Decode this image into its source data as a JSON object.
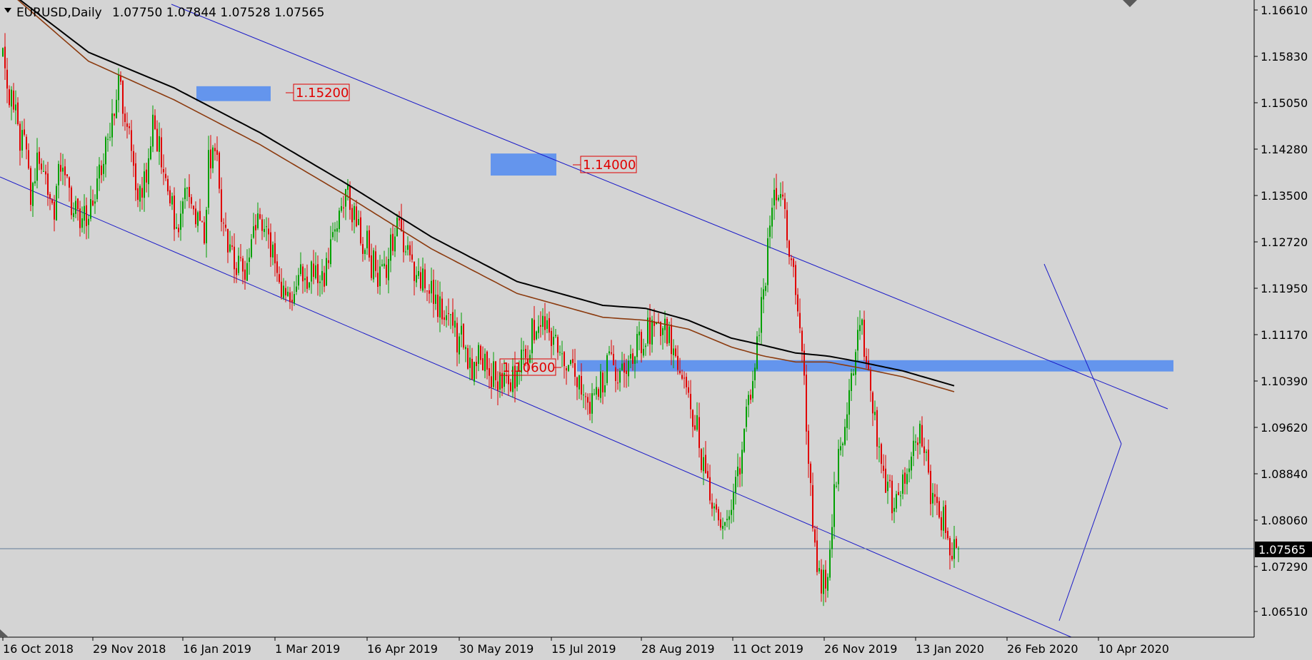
{
  "header": {
    "symbol": "EURUSD,Daily",
    "ohlc": "1.07750 1.07844 1.07528 1.07565"
  },
  "colors": {
    "background": "#d4d4d4",
    "bull": "#00a000",
    "bear": "#e00000",
    "ma_fast": "#8b3a0e",
    "ma_slow": "#000000",
    "trendline": "#1a1ac8",
    "zone": "#6495ed"
  },
  "chart_data": {
    "type": "candlestick",
    "title": "EURUSD,Daily",
    "ylim": [
      1.062,
      1.165
    ],
    "y_ticks": [
      "1.16610",
      "1.15830",
      "1.15050",
      "1.14280",
      "1.13500",
      "1.12720",
      "1.11950",
      "1.11170",
      "1.10390",
      "1.09620",
      "1.08840",
      "1.08060",
      "1.07290",
      "1.06510"
    ],
    "x_ticks": [
      "16 Oct 2018",
      "29 Nov 2018",
      "16 Jan 2019",
      "1 Mar 2019",
      "16 Apr 2019",
      "30 May 2019",
      "15 Jul 2019",
      "28 Aug 2019",
      "11 Oct 2019",
      "26 Nov 2019",
      "13 Jan 2020",
      "26 Feb 2020",
      "10 Apr 2020"
    ],
    "current_price": "1.07565",
    "levels": [
      {
        "price": 1.152,
        "label": "1.15200"
      },
      {
        "price": 1.14,
        "label": "1.14000"
      },
      {
        "price": 1.106,
        "label": "1.10600"
      }
    ],
    "path_points": [
      [
        0,
        1.158
      ],
      [
        4,
        1.15
      ],
      [
        8,
        1.144
      ],
      [
        10,
        1.146
      ],
      [
        13,
        1.135
      ],
      [
        17,
        1.142
      ],
      [
        20,
        1.138
      ],
      [
        24,
        1.133
      ],
      [
        27,
        1.14
      ],
      [
        32,
        1.134
      ],
      [
        36,
        1.13
      ],
      [
        40,
        1.132
      ],
      [
        44,
        1.137
      ],
      [
        48,
        1.144
      ],
      [
        52,
        1.15
      ],
      [
        54,
        1.154
      ],
      [
        58,
        1.148
      ],
      [
        62,
        1.139
      ],
      [
        64,
        1.134
      ],
      [
        68,
        1.141
      ],
      [
        70,
        1.148
      ],
      [
        74,
        1.142
      ],
      [
        78,
        1.133
      ],
      [
        82,
        1.13
      ],
      [
        86,
        1.136
      ],
      [
        90,
        1.133
      ],
      [
        94,
        1.129
      ],
      [
        96,
        1.141
      ],
      [
        100,
        1.143
      ],
      [
        102,
        1.132
      ],
      [
        106,
        1.125
      ],
      [
        110,
        1.122
      ],
      [
        114,
        1.122
      ],
      [
        118,
        1.129
      ],
      [
        122,
        1.131
      ],
      [
        126,
        1.125
      ],
      [
        130,
        1.12
      ],
      [
        134,
        1.117
      ],
      [
        138,
        1.123
      ],
      [
        142,
        1.12
      ],
      [
        146,
        1.124
      ],
      [
        150,
        1.121
      ],
      [
        154,
        1.127
      ],
      [
        158,
        1.131
      ],
      [
        160,
        1.135
      ],
      [
        164,
        1.133
      ],
      [
        168,
        1.128
      ],
      [
        172,
        1.124
      ],
      [
        176,
        1.121
      ],
      [
        180,
        1.125
      ],
      [
        184,
        1.13
      ],
      [
        188,
        1.127
      ],
      [
        192,
        1.122
      ],
      [
        196,
        1.12
      ],
      [
        200,
        1.118
      ],
      [
        204,
        1.116
      ],
      [
        208,
        1.114
      ],
      [
        212,
        1.111
      ],
      [
        216,
        1.109
      ],
      [
        220,
        1.106
      ],
      [
        224,
        1.108
      ],
      [
        228,
        1.105
      ],
      [
        232,
        1.104
      ],
      [
        236,
        1.102
      ],
      [
        240,
        1.106
      ],
      [
        244,
        1.108
      ],
      [
        248,
        1.112
      ],
      [
        252,
        1.114
      ],
      [
        256,
        1.112
      ],
      [
        260,
        1.109
      ],
      [
        264,
        1.107
      ],
      [
        268,
        1.104
      ],
      [
        272,
        1.101
      ],
      [
        276,
        1.1
      ],
      [
        280,
        1.105
      ],
      [
        284,
        1.106
      ],
      [
        288,
        1.104
      ],
      [
        292,
        1.107
      ],
      [
        296,
        1.11
      ],
      [
        300,
        1.112
      ],
      [
        304,
        1.114
      ],
      [
        308,
        1.113
      ],
      [
        312,
        1.11
      ],
      [
        316,
        1.105
      ],
      [
        320,
        1.1
      ],
      [
        324,
        1.095
      ],
      [
        328,
        1.088
      ],
      [
        332,
        1.082
      ],
      [
        336,
        1.079
      ],
      [
        340,
        1.082
      ],
      [
        344,
        1.09
      ],
      [
        348,
        1.1
      ],
      [
        352,
        1.11
      ],
      [
        356,
        1.122
      ],
      [
        360,
        1.135
      ],
      [
        364,
        1.133
      ],
      [
        368,
        1.125
      ],
      [
        372,
        1.115
      ],
      [
        376,
        1.09
      ],
      [
        380,
        1.07
      ],
      [
        384,
        1.07
      ],
      [
        388,
        1.085
      ],
      [
        392,
        1.095
      ],
      [
        396,
        1.105
      ],
      [
        400,
        1.115
      ],
      [
        404,
        1.105
      ],
      [
        408,
        1.095
      ],
      [
        412,
        1.087
      ],
      [
        416,
        1.082
      ],
      [
        420,
        1.087
      ],
      [
        424,
        1.092
      ],
      [
        428,
        1.094
      ],
      [
        432,
        1.087
      ],
      [
        436,
        1.083
      ],
      [
        440,
        1.079
      ],
      [
        444,
        1.076
      ]
    ],
    "candle_count": 447,
    "ma_slow_points": [
      [
        0,
        1.17
      ],
      [
        40,
        1.159
      ],
      [
        80,
        1.153
      ],
      [
        120,
        1.1455
      ],
      [
        160,
        1.137
      ],
      [
        200,
        1.128
      ],
      [
        240,
        1.1205
      ],
      [
        260,
        1.1185
      ],
      [
        280,
        1.1165
      ],
      [
        300,
        1.116
      ],
      [
        320,
        1.114
      ],
      [
        340,
        1.111
      ],
      [
        355,
        1.1098
      ],
      [
        370,
        1.1085
      ],
      [
        385,
        1.108
      ],
      [
        400,
        1.107
      ],
      [
        420,
        1.1055
      ],
      [
        444,
        1.103
      ]
    ],
    "ma_fast_points": [
      [
        0,
        1.17
      ],
      [
        40,
        1.1575
      ],
      [
        80,
        1.151
      ],
      [
        120,
        1.1435
      ],
      [
        160,
        1.135
      ],
      [
        200,
        1.126
      ],
      [
        240,
        1.1185
      ],
      [
        260,
        1.1165
      ],
      [
        280,
        1.1145
      ],
      [
        300,
        1.114
      ],
      [
        320,
        1.1125
      ],
      [
        340,
        1.1095
      ],
      [
        355,
        1.108
      ],
      [
        370,
        1.107
      ],
      [
        385,
        1.107
      ],
      [
        400,
        1.106
      ],
      [
        420,
        1.1045
      ],
      [
        444,
        1.102
      ]
    ]
  }
}
